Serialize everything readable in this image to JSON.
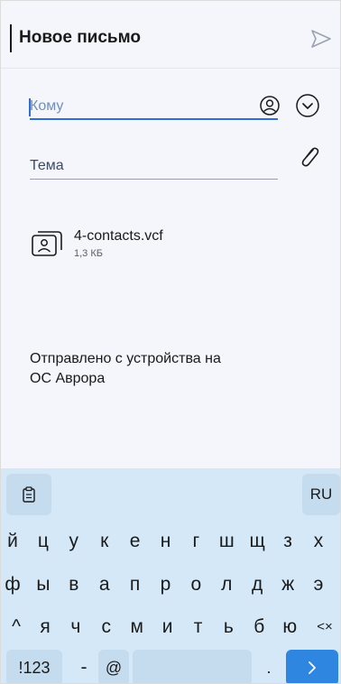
{
  "header": {
    "title": "Новое письмо",
    "send_icon": "send-arrow-icon"
  },
  "compose": {
    "to_placeholder": "Кому",
    "subject_placeholder": "Тема",
    "contacts_icon": "contact-person-icon",
    "expand_icon": "chevron-down-icon",
    "attach_icon": "paperclip-icon"
  },
  "attachment": {
    "file_name": "4-contacts.vcf",
    "file_size": "1,3 КБ",
    "icon": "contact-card-icon"
  },
  "signature": {
    "line1": "Отправлено с устройства на",
    "line2": "ОС Аврора"
  },
  "keyboard": {
    "clipboard_icon": "clipboard-icon",
    "language": "RU",
    "row1": [
      "й",
      "ц",
      "у",
      "к",
      "е",
      "н",
      "г",
      "ш",
      "щ",
      "з",
      "х"
    ],
    "row2": [
      "ф",
      "ы",
      "в",
      "а",
      "п",
      "р",
      "о",
      "л",
      "д",
      "ж",
      "э"
    ],
    "row3": [
      "я",
      "ч",
      "с",
      "м",
      "и",
      "т",
      "ь",
      "б",
      "ю"
    ],
    "shift_symbol": "^",
    "backspace_symbol": "<×",
    "numbers_label": "!123",
    "dash": "-",
    "at": "@",
    "dot": ".",
    "enter_symbol": ">"
  },
  "colors": {
    "accent": "#2f86e0",
    "keyboard_bg": "#d4e8f8",
    "key_fn_bg": "#c4dcee",
    "background": "#f4f6fb"
  }
}
